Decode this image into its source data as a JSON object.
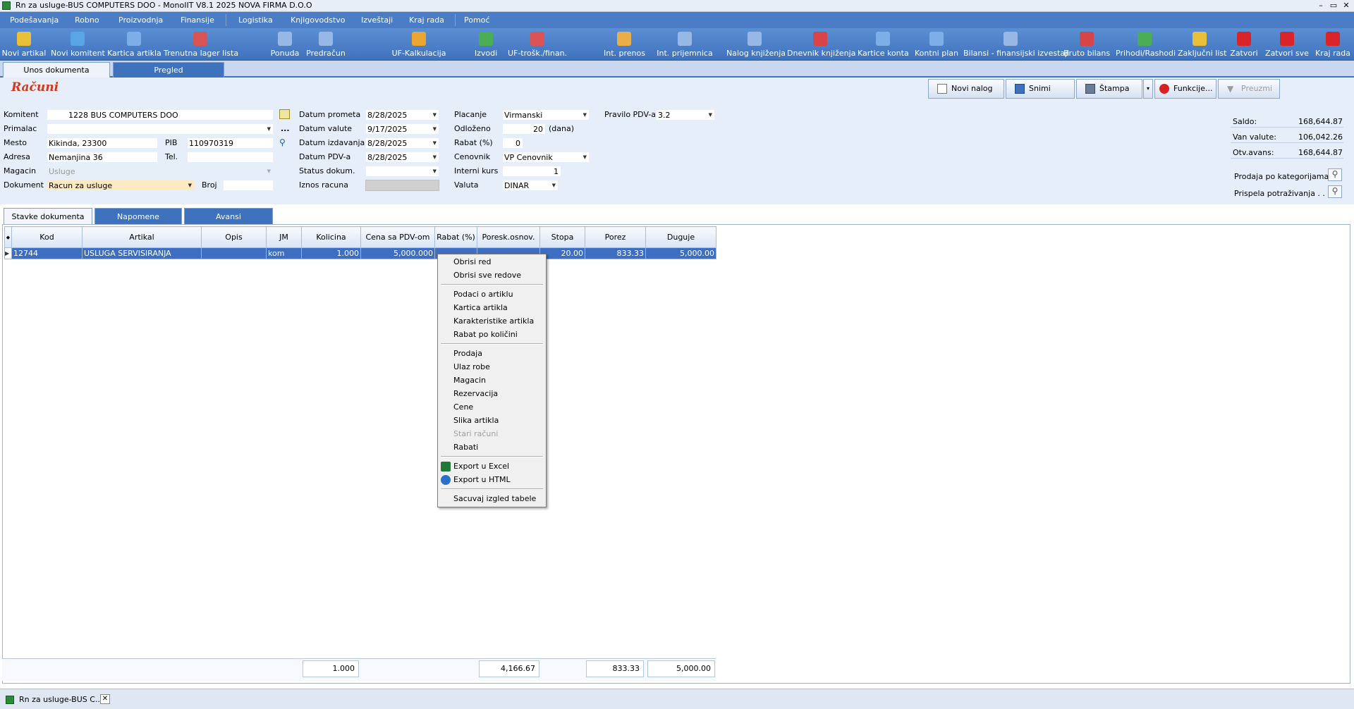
{
  "window": {
    "title": "Rn za usluge-BUS COMPUTERS DOO - MonoIIT V8.1 2025 NOVA FIRMA D.O.O",
    "controls": [
      "–",
      "▭",
      "✕"
    ]
  },
  "menu": [
    "Podešavanja",
    "Robno",
    "Proizvodnja",
    "Finansije",
    "Logistika",
    "Knjigovodstvo",
    "Izveštaji",
    "Kraj rada",
    "Pomoć"
  ],
  "toolbar": [
    {
      "label": "Novi artikal",
      "icon": "new-item-icon",
      "color": "#f2c230"
    },
    {
      "label": "Novi komitent",
      "icon": "new-partner-icon",
      "color": "#5aa6e6"
    },
    {
      "label": "Kartica artikla",
      "icon": "item-card-icon",
      "color": "#7fb0e8"
    },
    {
      "label": "Trenutna lager lista",
      "icon": "stock-list-icon",
      "color": "#e25050"
    },
    {
      "label": "Ponuda",
      "icon": "offer-icon",
      "color": "#9bbbe6"
    },
    {
      "label": "Predračun",
      "icon": "proforma-icon",
      "color": "#9bbbe6"
    },
    {
      "label": "UF-Kalkulacija",
      "icon": "calculation-icon",
      "color": "#f2a62a"
    },
    {
      "label": "Izvodi",
      "icon": "statements-icon",
      "color": "#4caf50"
    },
    {
      "label": "UF-trošk./finan.",
      "icon": "costs-icon",
      "color": "#e25050"
    },
    {
      "label": "Int. prenos",
      "icon": "transfer-icon",
      "color": "#f2b040"
    },
    {
      "label": "Int. prijemnica",
      "icon": "receipt-icon",
      "color": "#9bbbe6"
    },
    {
      "label": "Nalog knjiženja",
      "icon": "posting-order-icon",
      "color": "#9bbbe6"
    },
    {
      "label": "Dnevnik knjiženja",
      "icon": "journal-icon",
      "color": "#e04040"
    },
    {
      "label": "Kartice konta",
      "icon": "account-cards-icon",
      "color": "#7fb0e8"
    },
    {
      "label": "Kontni plan",
      "icon": "chart-of-accounts-icon",
      "color": "#7fb0e8"
    },
    {
      "label": "Bilansi - finansijski izvestaji",
      "icon": "balance-icon",
      "color": "#9bbbe6"
    },
    {
      "label": "Bruto bilans",
      "icon": "gross-balance-icon",
      "color": "#e04040"
    },
    {
      "label": "Prihodi/Rashodi",
      "icon": "income-expense-icon",
      "color": "#4caf50"
    },
    {
      "label": "Zaključni list",
      "icon": "closing-sheet-icon",
      "color": "#f2c230"
    },
    {
      "label": "Zatvori",
      "icon": "close-icon",
      "color": "#e02020"
    },
    {
      "label": "Zatvori sve",
      "icon": "close-all-icon",
      "color": "#e02020"
    },
    {
      "label": "Kraj rada",
      "icon": "power-icon",
      "color": "#e02020"
    }
  ],
  "topTabs": [
    "Unos dokumenta",
    "Pregled"
  ],
  "pageTitle": "Računi",
  "actions": {
    "novi": "Novi nalog",
    "snimi": "Snimi",
    "stampa": "Štampa",
    "funkcije": "Funkcije...",
    "preuzmi": "Preuzmi"
  },
  "form": {
    "komitent": {
      "label": "Komitent",
      "value": "1228 BUS COMPUTERS DOO"
    },
    "primalac": {
      "label": "Primalac",
      "value": ""
    },
    "mesto": {
      "label": "Mesto",
      "value": "Kikinda, 23300"
    },
    "pib": {
      "label": "PIB",
      "value": "110970319"
    },
    "adresa": {
      "label": "Adresa",
      "value": "Nemanjina 36"
    },
    "tel": {
      "label": "Tel.",
      "value": ""
    },
    "magacin": {
      "label": "Magacin",
      "value": "Usluge"
    },
    "dokument": {
      "label": "Dokument",
      "value": "Racun za usluge"
    },
    "broj": {
      "label": "Broj",
      "value": ""
    },
    "datumPrometa": {
      "label": "Datum prometa",
      "value": "8/28/2025"
    },
    "datumValute": {
      "label": "Datum valute",
      "value": "9/17/2025"
    },
    "datumIzdavanja": {
      "label": "Datum izdavanja",
      "value": "8/28/2025"
    },
    "datumPdv": {
      "label": "Datum PDV-a",
      "value": "8/28/2025"
    },
    "statusDokum": {
      "label": "Status dokum.",
      "value": ""
    },
    "iznosRacuna": {
      "label": "Iznos racuna",
      "value": ""
    },
    "placanje": {
      "label": "Placanje",
      "value": "Virmanski"
    },
    "odlozeno": {
      "label": "Odloženo",
      "value": "20",
      "unit": "(dana)"
    },
    "rabat": {
      "label": "Rabat (%)",
      "value": "0"
    },
    "cenovnik": {
      "label": "Cenovnik",
      "value": "VP Cenovnik"
    },
    "interniKurs": {
      "label": "Interni kurs",
      "value": "1"
    },
    "valuta": {
      "label": "Valuta",
      "value": "DINAR"
    },
    "pravilo": {
      "label": "Pravilo PDV-a",
      "value": "3.2"
    },
    "ellipsis": "..."
  },
  "balances": [
    {
      "label": "Saldo:",
      "value": "168,644.87"
    },
    {
      "label": "Van valute:",
      "value": "106,042.26"
    },
    {
      "label": "Otv.avans:",
      "value": "168,644.87"
    }
  ],
  "reports": [
    "Prodaja po kategorijama",
    "Prispela potraživanja . ."
  ],
  "subTabs": [
    "Stavke dokumenta",
    "Napomene",
    "Avansi"
  ],
  "grid": {
    "columns": [
      "Kod",
      "Artikal",
      "Opis",
      "JM",
      "Kolicina",
      "Cena sa PDV-om",
      "Rabat (%)",
      "Poresk.osnov.",
      "Stopa",
      "Porez",
      "Duguje"
    ],
    "rows": [
      [
        "12744",
        "USLUGA SERVISIRANJA",
        "",
        "kom",
        "1.000",
        "5,000.000",
        "",
        "",
        "20.00",
        "833.33",
        "5,000.00"
      ]
    ],
    "totals": {
      "kolicina": "1.000",
      "osnovica": "4,166.67",
      "porez": "833.33",
      "duguje": "5,000.00"
    }
  },
  "contextMenu": [
    {
      "label": "Obrisi red"
    },
    {
      "label": "Obrisi sve redove"
    },
    {
      "sep": true
    },
    {
      "label": "Podaci o artiklu"
    },
    {
      "label": "Kartica artikla"
    },
    {
      "label": "Karakteristike artikla"
    },
    {
      "label": "Rabat po količini"
    },
    {
      "sep": true
    },
    {
      "label": "Prodaja"
    },
    {
      "label": "Ulaz robe"
    },
    {
      "label": "Magacin"
    },
    {
      "label": "Rezervacija"
    },
    {
      "label": "Cene"
    },
    {
      "label": "Slika artikla"
    },
    {
      "label": "Stari računi",
      "disabled": true
    },
    {
      "label": "Rabati"
    },
    {
      "sep": true
    },
    {
      "label": "Export u Excel",
      "icon": "excel-icon"
    },
    {
      "label": "Export u HTML",
      "icon": "html-icon"
    },
    {
      "sep": true
    },
    {
      "label": "Sacuvaj izgled tabele"
    }
  ],
  "taskbar": {
    "label": "Rn za usluge-BUS C..."
  }
}
